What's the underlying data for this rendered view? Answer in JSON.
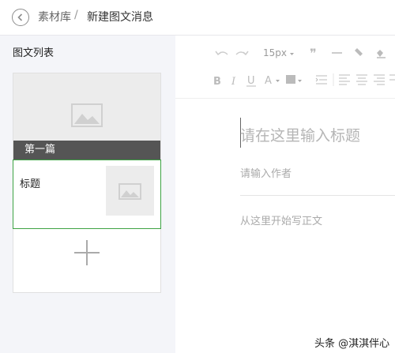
{
  "header": {
    "breadcrumb_parent": "素材库",
    "breadcrumb_separator": "/",
    "breadcrumb_current": "新建图文消息"
  },
  "sidebar": {
    "title": "图文列表",
    "articles": [
      {
        "label": "第一篇",
        "thumbnail_icon": "image-placeholder-icon"
      },
      {
        "label": "标题",
        "thumbnail_icon": "image-placeholder-icon"
      }
    ],
    "add_icon": "plus-icon"
  },
  "toolbar": {
    "font_size": "15px",
    "icons": [
      "undo-icon",
      "redo-icon",
      "font-size-dropdown",
      "quote-icon",
      "horizontal-rule-icon",
      "format-painter-icon",
      "clear-format-icon",
      "bold-icon",
      "italic-icon",
      "underline-icon",
      "font-color-icon",
      "background-color-icon",
      "indent-icon",
      "align-left-icon",
      "align-center-icon",
      "align-right-icon"
    ]
  },
  "editor": {
    "title_placeholder": "请在这里输入标题",
    "author_placeholder": "请输入作者",
    "body_placeholder": "从这里开始写正文"
  },
  "watermark": "头条 @淇淇伴心",
  "colors": {
    "selected_border": "#3ea344",
    "active_article_bg": "#555555",
    "sidebar_bg": "#f4f5f9"
  }
}
